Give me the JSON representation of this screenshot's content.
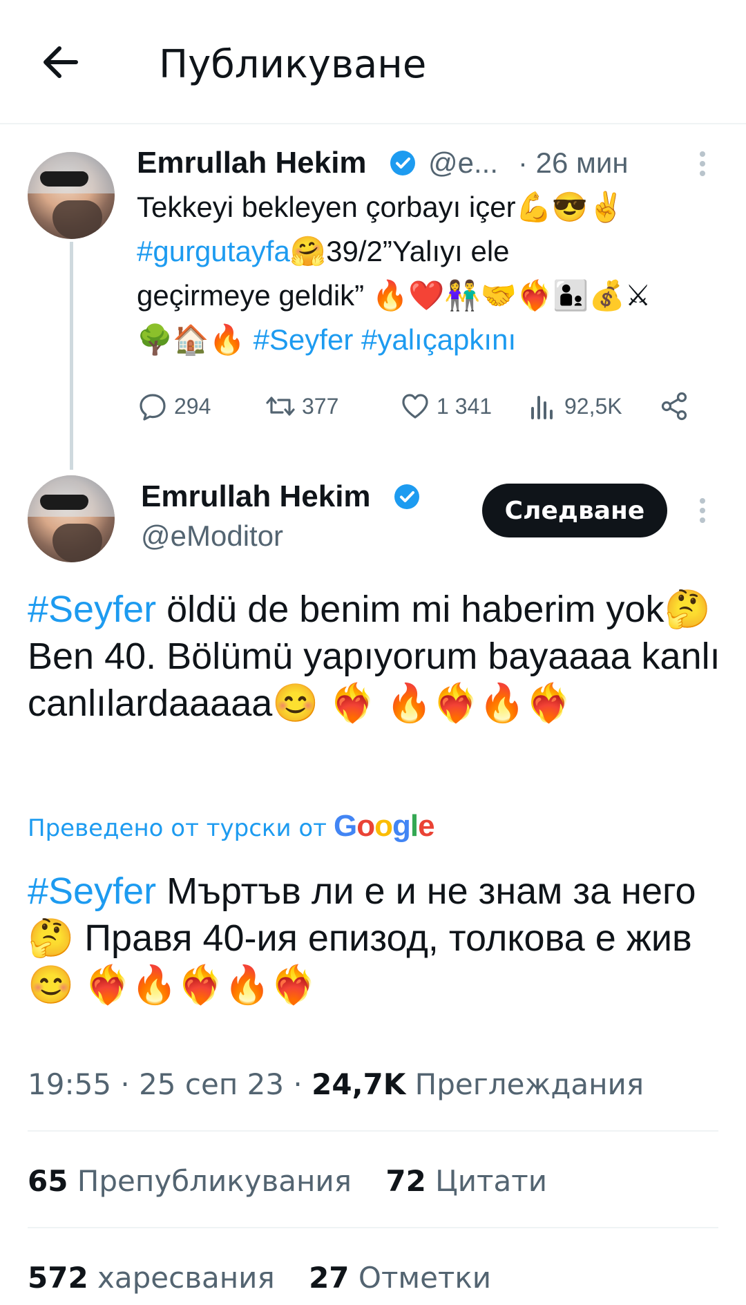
{
  "header": {
    "title": "Публикуване"
  },
  "parent_tweet": {
    "name": "Emrullah Hekim",
    "handle": "@e...",
    "time": "· 26 мин",
    "body_line1": "Tekkeyi bekleyen çorbayı içer💪😎✌",
    "tag1": "#gurgutayfa",
    "body_line2": "🤗39/2”Yalıyı ele",
    "body_line3": "geçirmeye geldik” 🔥❤️👫🤝❤️‍🔥👨‍👦💰⚔",
    "body_line4_emoji": "🌳🏠🔥",
    "tag2": "#Seyfer",
    "tag3": "#yalıçapkını",
    "replies": "294",
    "reposts": "377",
    "likes": "1 341",
    "views": "92,5K"
  },
  "main_tweet": {
    "name": "Emrullah Hekim",
    "handle": "@eModitor",
    "follow_label": "Следване",
    "tag": "#Seyfer",
    "original_rest": " öldü de benim mi haberim yok🤔 Ben 40. Bölümü yapıyorum bayaaaa kanlı canlılardaaaaa😊     ❤️‍🔥 🔥❤️‍🔥🔥❤️‍🔥",
    "translated_label": "Преведено от турски от",
    "google_word": "Google",
    "translation_tag": "#Seyfer",
    "translation_rest": " Мъртъв ли е и не знам за него 🤔 Правя 40-ия епизод, толкова е жив 😊     ❤️‍🔥🔥❤️‍🔥🔥❤️‍🔥",
    "time": "19:55 · 25 сеп 23 · ",
    "views_count": "24,7K",
    "views_label": " Преглеждания",
    "reposts_count": "65",
    "reposts_label": " Препубликувания",
    "quotes_count": "72",
    "quotes_label": " Цитати",
    "likes_count": "572",
    "likes_label": " харесвания",
    "bookmarks_count": "27",
    "bookmarks_label": " Отметки"
  },
  "colors": {
    "accent": "#1d9bf0",
    "text": "#0f1419",
    "muted": "#536471",
    "verified": "#1d9bf0"
  }
}
